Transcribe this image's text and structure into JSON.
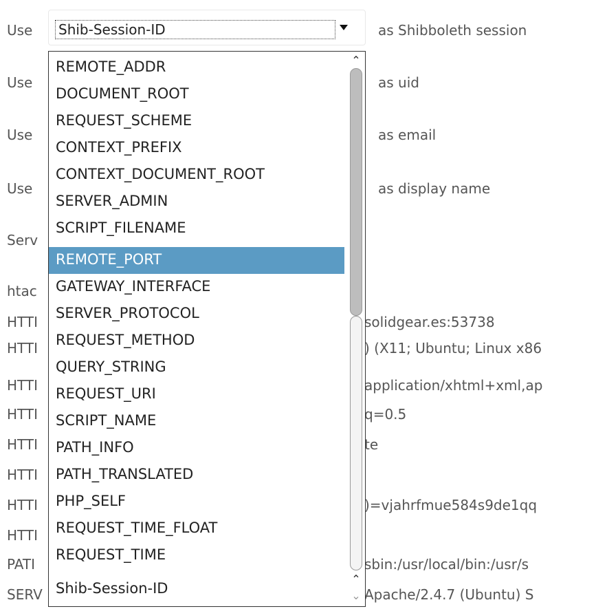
{
  "form": {
    "rows": [
      {
        "prefix": "Use",
        "suffix": "as Shibboleth session"
      },
      {
        "prefix": "Use",
        "suffix": "as uid"
      },
      {
        "prefix": "Use",
        "suffix": "as email"
      },
      {
        "prefix": "Use",
        "suffix": "as display name"
      }
    ],
    "selected_value": "Shib-Session-ID"
  },
  "background_rows": {
    "labels": [
      "Serv",
      "htac",
      "HTTI",
      "HTTI",
      "HTTI",
      "HTTI",
      "HTTI",
      "HTTI",
      "HTTI",
      "HTTI",
      "PATI",
      "SERV"
    ],
    "values": [
      "solidgear.es:53738",
      ") (X11; Ubuntu; Linux x86",
      "application/xhtml+xml,ap",
      "q=0.5",
      "te",
      ")=vjahrfmue584s9de1qq",
      "sbin:/usr/local/bin:/usr/s",
      "Apache/2.4.7 (Ubuntu) S"
    ]
  },
  "dropdown": {
    "options": [
      "REMOTE_ADDR",
      "DOCUMENT_ROOT",
      "REQUEST_SCHEME",
      "CONTEXT_PREFIX",
      "CONTEXT_DOCUMENT_ROOT",
      "SERVER_ADMIN",
      "SCRIPT_FILENAME",
      "REMOTE_PORT",
      "GATEWAY_INTERFACE",
      "SERVER_PROTOCOL",
      "REQUEST_METHOD",
      "QUERY_STRING",
      "REQUEST_URI",
      "SCRIPT_NAME",
      "PATH_INFO",
      "PATH_TRANSLATED",
      "PHP_SELF",
      "REQUEST_TIME_FLOAT",
      "REQUEST_TIME",
      "Shib-Session-ID"
    ],
    "highlighted_option": "REMOTE_PORT",
    "scroll_up_icon": "chevron-up-icon",
    "scroll_down_icon": "chevron-down-icon"
  },
  "colors": {
    "highlight": "#5b9bc4",
    "text": "#555555"
  }
}
